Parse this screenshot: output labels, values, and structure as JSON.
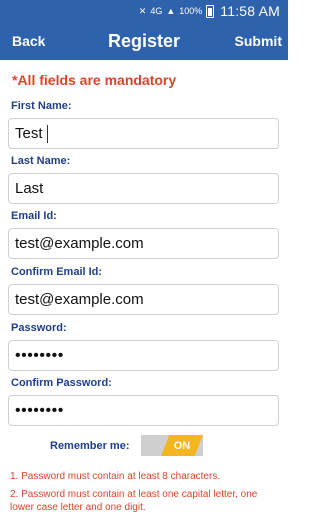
{
  "status": {
    "battery": "100%",
    "time": "11:58 AM",
    "network": "4G"
  },
  "appbar": {
    "back": "Back",
    "title": "Register",
    "submit": "Submit"
  },
  "notice": "*All fields are mandatory",
  "fields": {
    "first_name": {
      "label": "First Name:",
      "value": "Test"
    },
    "last_name": {
      "label": "Last Name:",
      "value": "Last"
    },
    "email": {
      "label": "Email Id:",
      "value": "test@example.com"
    },
    "confirm_email": {
      "label": "Confirm Email Id:",
      "value": "test@example.com"
    },
    "password": {
      "label": "Password:",
      "value": "••••••••"
    },
    "confirm_password": {
      "label": "Confirm Password:",
      "value": "••••••••"
    }
  },
  "remember": {
    "label": "Remember me:",
    "state": "ON"
  },
  "rules": [
    "1. Password must contain at least 8 characters.",
    "2. Password must contain at least one capital letter, one lower case letter and one digit."
  ],
  "colors": {
    "primary": "#2f62ac",
    "accent": "#f3b520",
    "error": "#d9452b",
    "label": "#1f3f8a"
  }
}
